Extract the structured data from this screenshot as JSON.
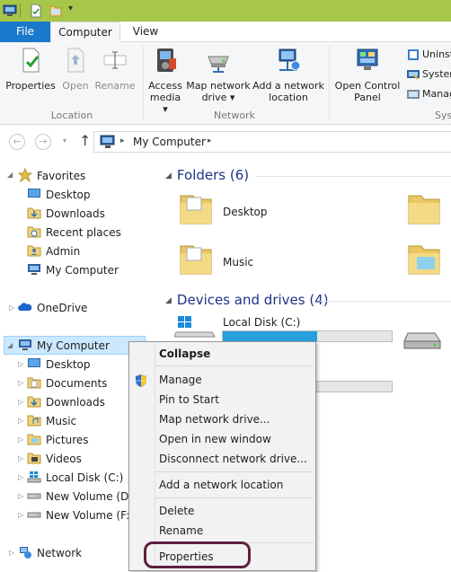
{
  "ribbon": {
    "tabs": {
      "file": "File",
      "computer": "Computer",
      "view": "View"
    },
    "location": {
      "label": "Location",
      "properties": "Properties",
      "open": "Open",
      "rename": "Rename"
    },
    "network": {
      "label": "Network",
      "access_media_1": "Access",
      "access_media_2": "media ▾",
      "map_drive_1": "Map network",
      "map_drive_2": "drive ▾",
      "add_location_1": "Add a network",
      "add_location_2": "location"
    },
    "system": {
      "label": "Syst",
      "control_panel_1": "Open Control",
      "control_panel_2": "Panel",
      "uninstall": "Uninst",
      "system_props": "System",
      "manage": "Manag"
    }
  },
  "address": {
    "path": "My Computer"
  },
  "nav": {
    "favorites": "Favorites",
    "desktop": "Desktop",
    "downloads": "Downloads",
    "recent": "Recent places",
    "admin": "Admin",
    "my_computer_fav": "My Computer",
    "onedrive": "OneDrive",
    "my_computer": "My Computer",
    "children": {
      "desktop": "Desktop",
      "documents": "Documents",
      "downloads": "Downloads",
      "music": "Music",
      "pictures": "Pictures",
      "videos": "Videos",
      "local_disk": "Local Disk (C:)",
      "new_volume_d": "New Volume (D:)",
      "new_volume_f": "New Volume (F:)"
    },
    "network": "Network"
  },
  "content": {
    "folders_header": "Folders (6)",
    "folder_desktop": "Desktop",
    "folder_music": "Music",
    "drives_header": "Devices and drives (4)",
    "local_disk": "Local Disk (C:)",
    "local_disk_fill": 0.56
  },
  "context_menu": {
    "collapse": "Collapse",
    "manage": "Manage",
    "pin_to_start": "Pin to Start",
    "map_drive": "Map network drive...",
    "open_new_window": "Open in new window",
    "disconnect": "Disconnect network drive...",
    "add_location": "Add a network location",
    "delete": "Delete",
    "rename": "Rename",
    "properties": "Properties"
  },
  "colors": {
    "titlebar": "#a6c74a",
    "file_tab": "#1979ca",
    "selection": "#cce8ff",
    "header_text": "#1e3287",
    "highlight_oval": "#5f1f3f"
  }
}
